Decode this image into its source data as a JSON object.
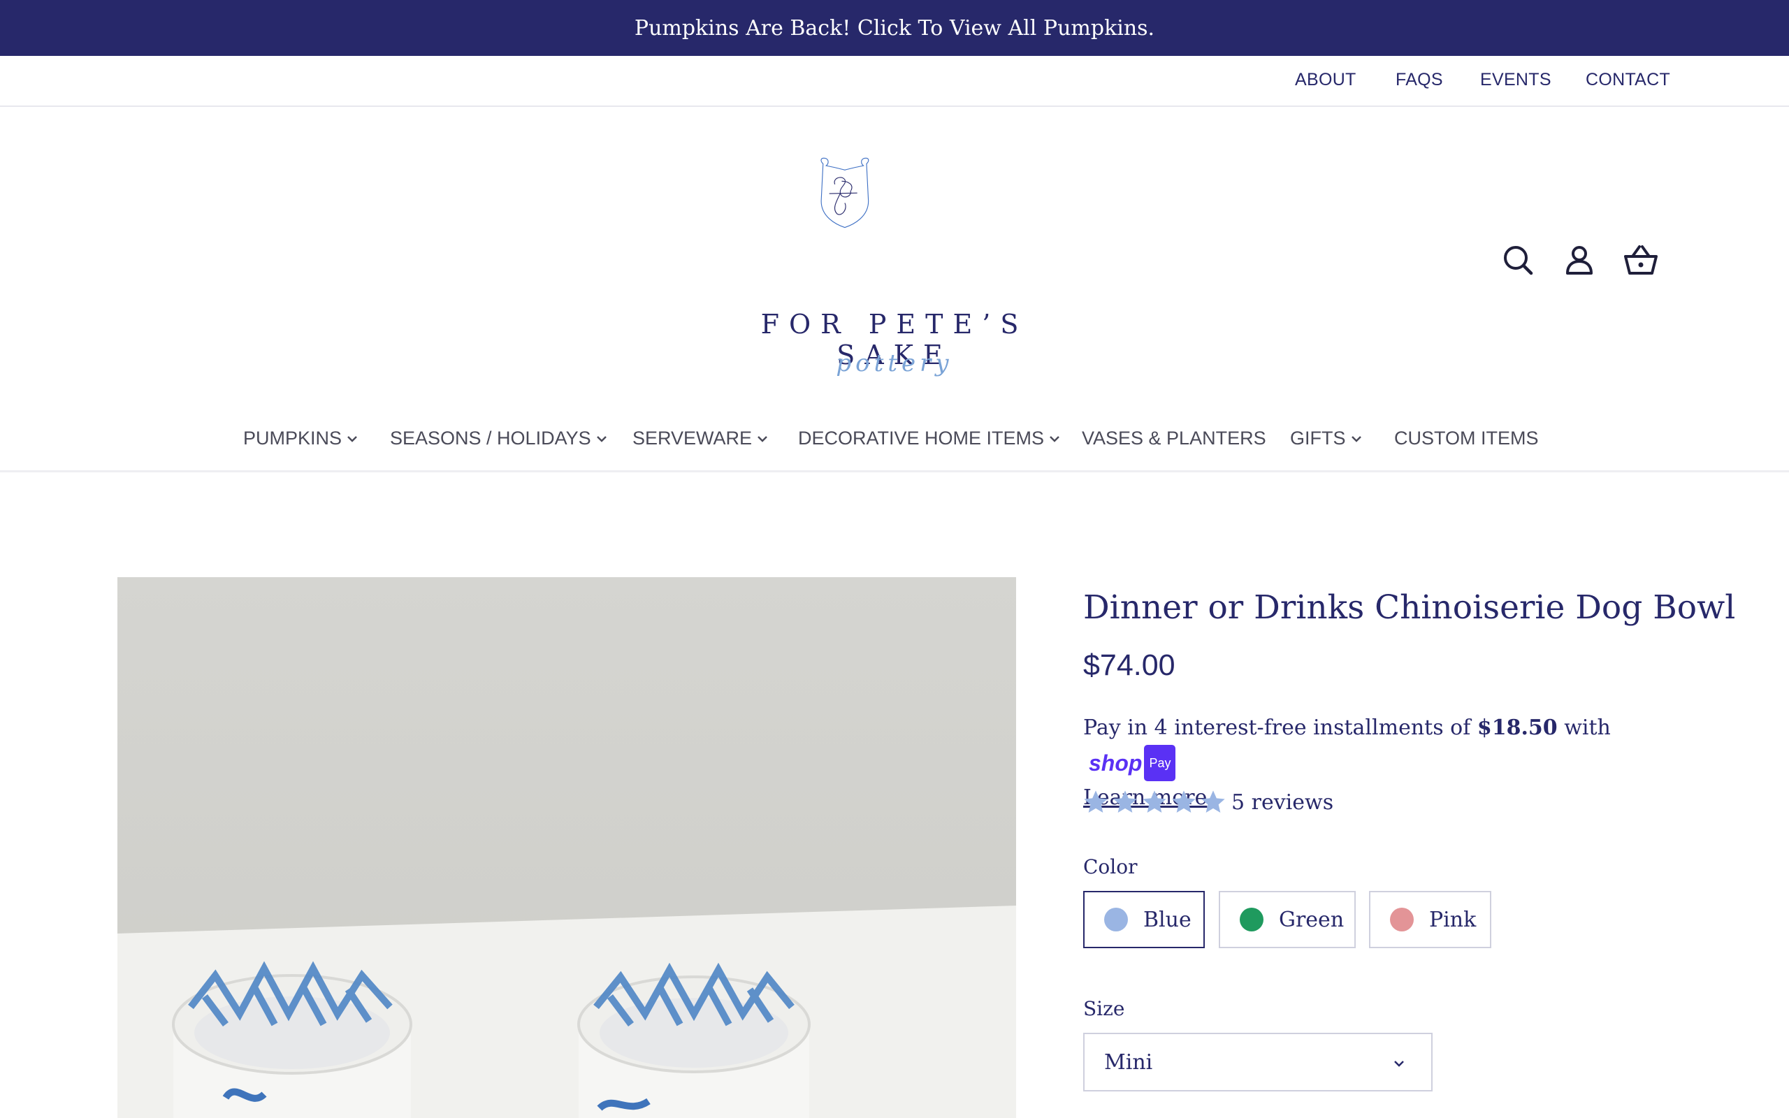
{
  "announcement": {
    "text": "Pumpkins Are Back! Click To View All Pumpkins."
  },
  "utility_nav": [
    "ABOUT",
    "FAQS",
    "EVENTS",
    "CONTACT"
  ],
  "logo": {
    "name": "FOR PETE’S SAKE",
    "sub": "pottery"
  },
  "header_icons": [
    "search-icon",
    "account-icon",
    "cart-basket-icon"
  ],
  "main_nav": [
    {
      "label": "PUMPKINS",
      "has_dropdown": true
    },
    {
      "label": "SEASONS / HOLIDAYS",
      "has_dropdown": true
    },
    {
      "label": "SERVEWARE",
      "has_dropdown": true
    },
    {
      "label": "DECORATIVE HOME ITEMS",
      "has_dropdown": true
    },
    {
      "label": "VASES & PLANTERS",
      "has_dropdown": false
    },
    {
      "label": "GIFTS",
      "has_dropdown": true
    },
    {
      "label": "CUSTOM ITEMS",
      "has_dropdown": false
    }
  ],
  "product": {
    "title": "Dinner or Drinks Chinoiserie Dog Bowl",
    "price": "$74.00",
    "installments": {
      "prefix": "Pay in 4 interest-free installments of",
      "amount": "$18.50",
      "with": "with",
      "shop_word": "shop",
      "shop_pay": "Pay",
      "learn_more": "Learn more"
    },
    "rating": {
      "stars": 5,
      "text": "5 reviews"
    },
    "color_label": "Color",
    "colors": [
      {
        "name": "Blue",
        "swatch": "#9ab5e3",
        "selected": true
      },
      {
        "name": "Green",
        "swatch": "#1f9a5e",
        "selected": false
      },
      {
        "name": "Pink",
        "swatch": "#e39497",
        "selected": false
      }
    ],
    "size_label": "Size",
    "size_selected": "Mini"
  },
  "colors": {
    "brand_navy": "#27286a",
    "star_blue": "#9ab5e3",
    "shop_purple": "#5a31f4"
  }
}
